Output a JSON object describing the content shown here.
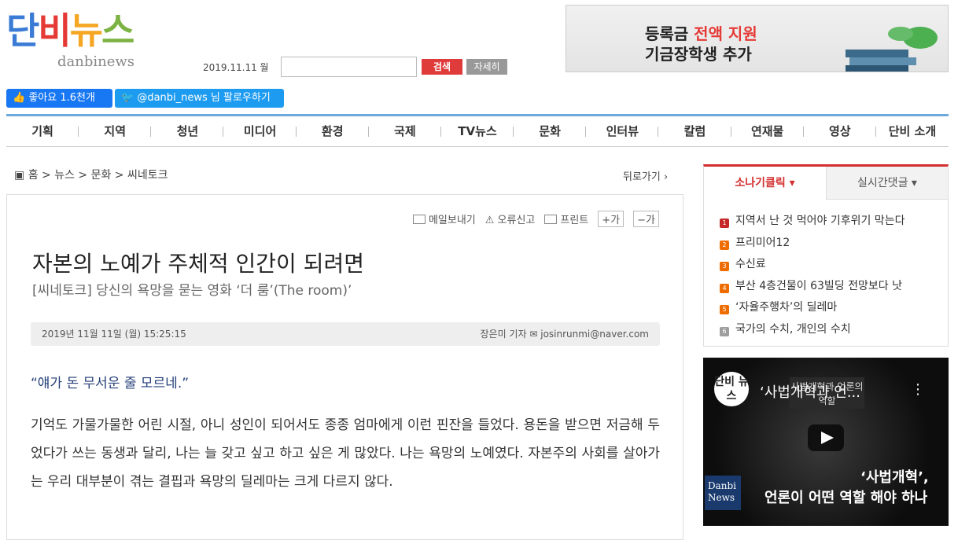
{
  "header": {
    "logo_ko": [
      "단",
      "비",
      "뉴",
      "스"
    ],
    "logo_en": "danbinews",
    "date": "2019.11.11 월",
    "search_placeholder": "",
    "search_label": "검색",
    "detail_label": "자세히"
  },
  "banner": {
    "line1_a": "등록금 ",
    "line1_b": "전액 지원",
    "line2": "기금장학생 추가"
  },
  "social": {
    "fb_label": "좋아요 1.6천개",
    "tw_label": "@danbi_news 님 팔로우하기"
  },
  "nav": {
    "items": [
      "기획",
      "지역",
      "청년",
      "미디어",
      "환경",
      "국제",
      "TV뉴스",
      "문화",
      "인터뷰",
      "칼럼",
      "연재물",
      "영상",
      "단비 소개"
    ]
  },
  "breadcrumb": {
    "text": "홈 > 뉴스 > 문화 > 씨네토크",
    "back": "뒤로가기"
  },
  "article": {
    "tools": [
      "메일보내기",
      "오류신고",
      "프린트"
    ],
    "font_plus": "+가",
    "font_minus": "−가",
    "title": "자본의 노예가 주체적 인간이 되려면",
    "subtitle": "[씨네토크] 당신의 욕망을 묻는 영화 ‘더 룸’(The room)’",
    "date": "2019년 11월 11일 (월) 15:25:15",
    "author": "장은미 기자",
    "email": "josinrunmi@naver.com",
    "quote": "“얘가 돈 무서운 줄 모르네.”",
    "body": "기억도 가물가물한 어린 시절, 아니 성인이 되어서도 종종 엄마에게 이런 핀잔을 들었다. 용돈을 받으면 저금해 두었다가 쓰는 동생과 달리, 나는 늘 갖고 싶고 하고 싶은 게 많았다. 나는 욕망의 노예였다. 자본주의 사회를 살아가는 우리 대부분이 겪는 결핍과 욕망의 딜레마는 크게 다르지 않다."
  },
  "sidebar": {
    "tab_active": "소나기클릭",
    "tab_inactive": "실시간댓글",
    "ranking": [
      {
        "num": "1",
        "text": "지역서 난 것 먹어야 기후위기 막는다",
        "color": "#c62828"
      },
      {
        "num": "2",
        "text": "프리미어12",
        "color": "#ef6c00"
      },
      {
        "num": "3",
        "text": "수신료",
        "color": "#ef6c00"
      },
      {
        "num": "4",
        "text": "부산 4층건물이 63빌딩 전망보다 낫",
        "color": "#ef6c00"
      },
      {
        "num": "5",
        "text": "‘자율주행차’의 딜레마",
        "color": "#ef6c00"
      },
      {
        "num": "6",
        "text": "국가의 수치, 개인의 수치",
        "color": "#9e9e9e"
      }
    ]
  },
  "video": {
    "logo": "단비 뉴스",
    "title": "‘사법개혁과 언...",
    "stage": "사법개혁과 언론의 역할",
    "brand": "Danbi News",
    "caption1": "‘사법개혁’,",
    "caption2": "언론이 어떤 역할 해야 하나"
  }
}
